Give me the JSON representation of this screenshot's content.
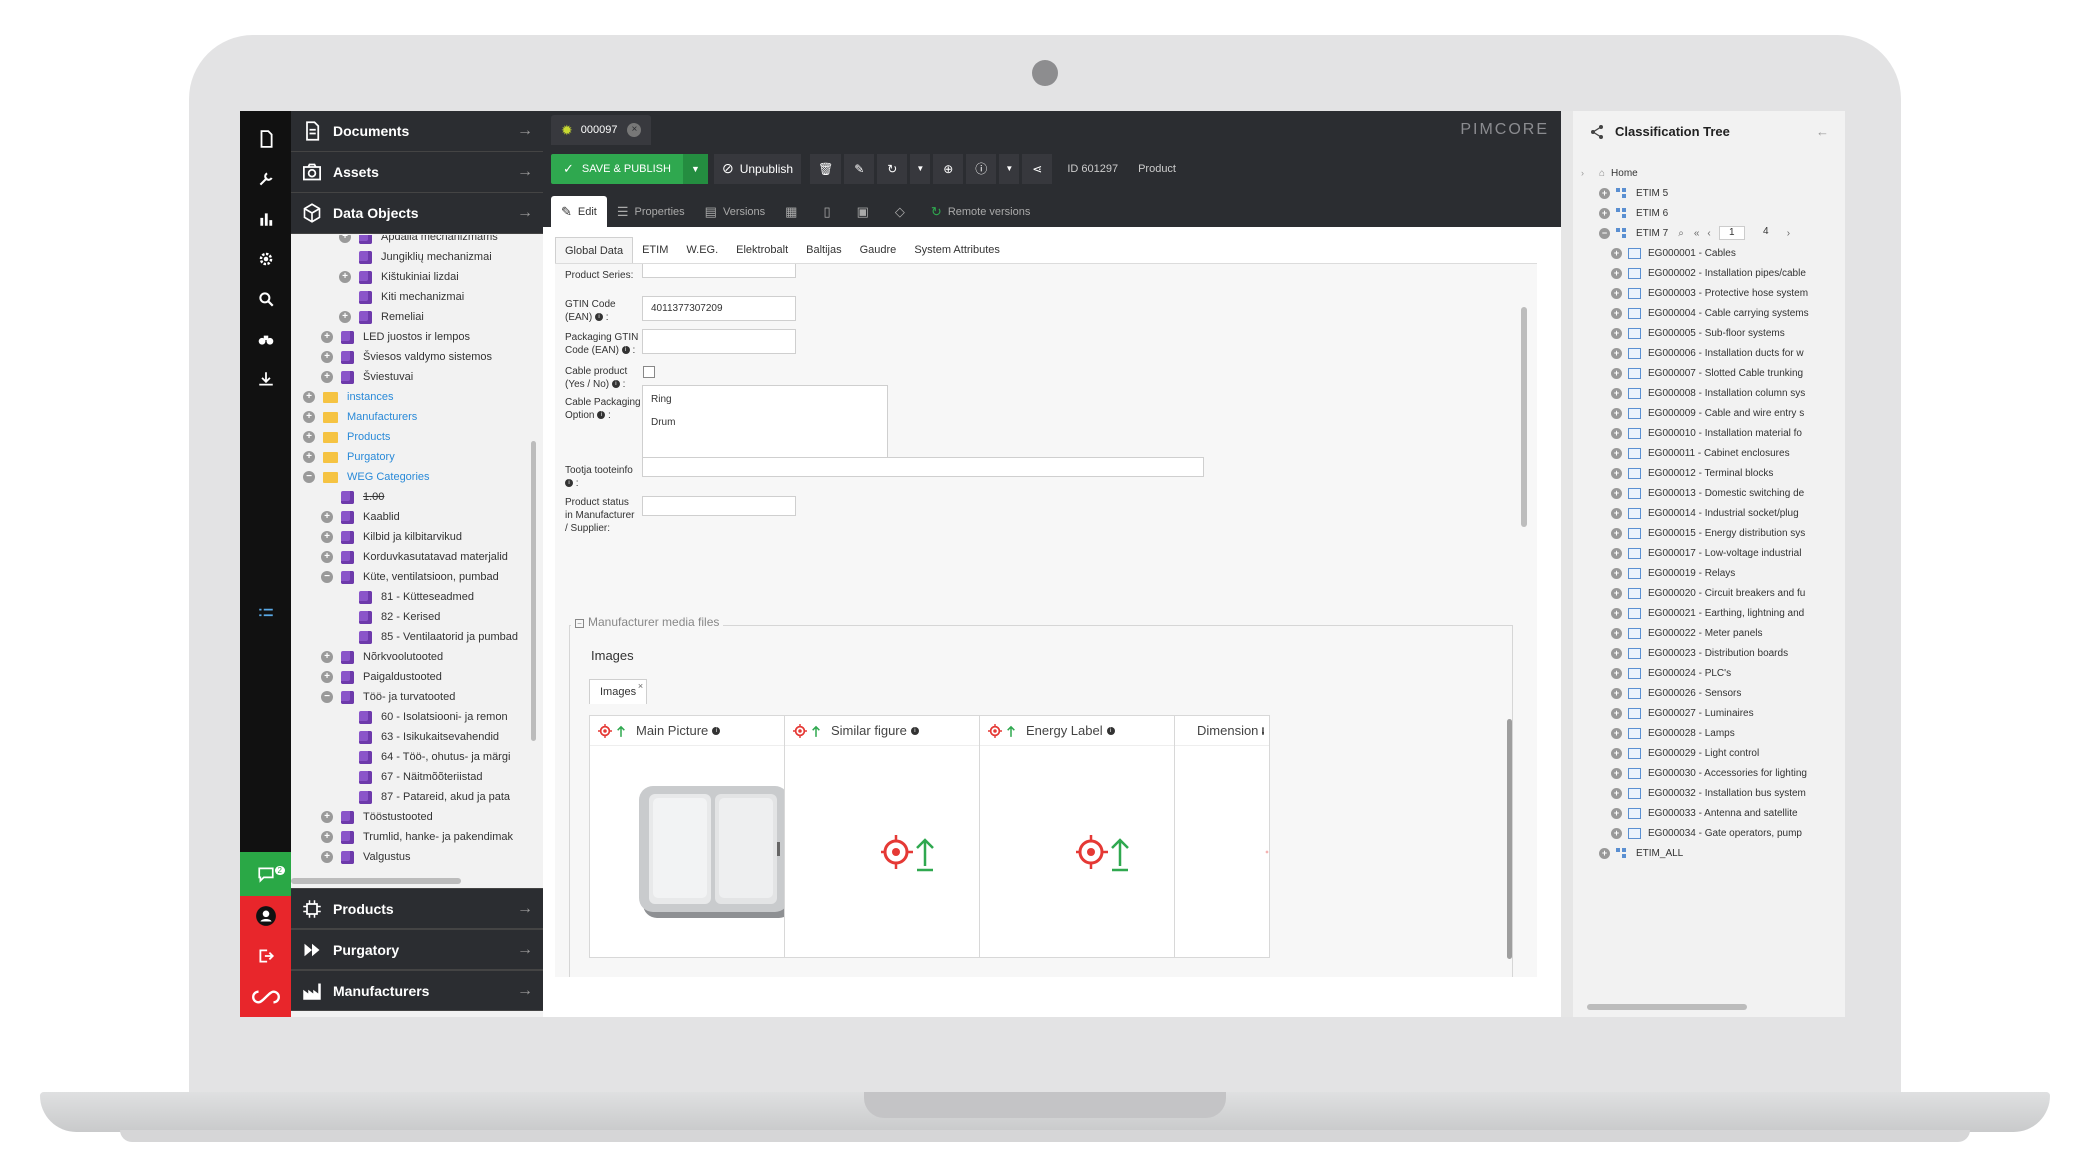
{
  "left_panels": {
    "documents": "Documents",
    "assets": "Assets",
    "data_objects": "Data Objects",
    "products": "Products",
    "purgatory": "Purgatory",
    "manufacturers": "Manufacturers"
  },
  "notifications_count": "2",
  "tree": [
    {
      "label": "Apdaila mechanizmams",
      "kind": "obj",
      "exp": "plus",
      "indent": 2
    },
    {
      "label": "Jungiklių mechanizmai",
      "kind": "obj",
      "exp": "none",
      "indent": 2
    },
    {
      "label": "Kištukiniai lizdai",
      "kind": "obj",
      "exp": "plus",
      "indent": 2
    },
    {
      "label": "Kiti mechanizmai",
      "kind": "obj",
      "exp": "none",
      "indent": 2
    },
    {
      "label": "Remeliai",
      "kind": "obj",
      "exp": "plus",
      "indent": 2
    },
    {
      "label": "LED juostos ir lempos",
      "kind": "obj",
      "exp": "plus",
      "indent": 1
    },
    {
      "label": "Šviesos valdymo sistemos",
      "kind": "obj",
      "exp": "plus",
      "indent": 1
    },
    {
      "label": "Šviestuvai",
      "kind": "obj",
      "exp": "plus",
      "indent": 1
    },
    {
      "label": "instances",
      "kind": "folder",
      "exp": "plus",
      "indent": 0,
      "blue": true
    },
    {
      "label": "Manufacturers",
      "kind": "folder",
      "exp": "plus",
      "indent": 0,
      "blue": true
    },
    {
      "label": "Products",
      "kind": "folder",
      "exp": "plus",
      "indent": 0,
      "blue": true
    },
    {
      "label": "Purgatory",
      "kind": "folder",
      "exp": "plus",
      "indent": 0,
      "blue": true
    },
    {
      "label": "WEG Categories",
      "kind": "folder",
      "exp": "minus",
      "indent": 0,
      "blue": true
    },
    {
      "label": "1.00",
      "kind": "obj",
      "exp": "none",
      "indent": 1,
      "strike": true
    },
    {
      "label": "Kaablid",
      "kind": "obj",
      "exp": "plus",
      "indent": 1
    },
    {
      "label": "Kilbid ja kilbitarvikud",
      "kind": "obj",
      "exp": "plus",
      "indent": 1
    },
    {
      "label": "Korduvkasutatavad materjalid",
      "kind": "obj",
      "exp": "plus",
      "indent": 1
    },
    {
      "label": "Küte, ventilatsioon, pumbad",
      "kind": "obj",
      "exp": "minus",
      "indent": 1
    },
    {
      "label": "81 - Kütteseadmed",
      "kind": "obj",
      "exp": "none",
      "indent": 2
    },
    {
      "label": "82 - Kerised",
      "kind": "obj",
      "exp": "none",
      "indent": 2
    },
    {
      "label": "85 - Ventilaatorid ja pumbad",
      "kind": "obj",
      "exp": "none",
      "indent": 2
    },
    {
      "label": "Nõrkvoolutooted",
      "kind": "obj",
      "exp": "plus",
      "indent": 1
    },
    {
      "label": "Paigaldustooted",
      "kind": "obj",
      "exp": "plus",
      "indent": 1
    },
    {
      "label": "Töö- ja turvatooted",
      "kind": "obj",
      "exp": "minus",
      "indent": 1
    },
    {
      "label": "60 - Isolatsiooni- ja remon",
      "kind": "obj",
      "exp": "none",
      "indent": 2
    },
    {
      "label": "63 - Isikukaitsevahendid",
      "kind": "obj",
      "exp": "none",
      "indent": 2
    },
    {
      "label": "64 - Töö-, ohutus- ja märgi",
      "kind": "obj",
      "exp": "none",
      "indent": 2
    },
    {
      "label": "67 - Näitmõõteriistad",
      "kind": "obj",
      "exp": "none",
      "indent": 2
    },
    {
      "label": "87 - Patareid, akud ja pata",
      "kind": "obj",
      "exp": "none",
      "indent": 2
    },
    {
      "label": "Tööstustooted",
      "kind": "obj",
      "exp": "plus",
      "indent": 1
    },
    {
      "label": "Trumlid, hanke- ja pakendimak",
      "kind": "obj",
      "exp": "plus",
      "indent": 1
    },
    {
      "label": "Valgustus",
      "kind": "obj",
      "exp": "plus",
      "indent": 1
    }
  ],
  "editor": {
    "tab_title": "000097",
    "logo": "PIMCORE",
    "save_publish": "SAVE & PUBLISH",
    "unpublish": "Unpublish",
    "object_id": "ID 601297",
    "class_name": "Product",
    "subtabs": {
      "edit": "Edit",
      "properties": "Properties",
      "versions": "Versions",
      "remote_versions": "Remote versions"
    },
    "inner_tabs": [
      "Global Data",
      "ETIM",
      "W.EG.",
      "Elektrobalt",
      "Baltijas",
      "Gaudre",
      "System Attributes"
    ]
  },
  "form": {
    "product_series_label": "Product Series:",
    "gtin_label_1": "GTIN Code",
    "gtin_label_2": "(EAN)",
    "gtin_value": "4011377307209",
    "pack_gtin_label_1": "Packaging GTIN",
    "pack_gtin_label_2": "Code (EAN)",
    "cable_product_label_1": "Cable product",
    "cable_product_label_2": "(Yes / No)",
    "cable_pack_label_1": "Cable Packaging",
    "cable_pack_label_2": "Option",
    "cable_pack_options": [
      "Ring",
      "Drum"
    ],
    "tootja_label_1": "Tootja tooteinfo",
    "status_label_1": "Product status",
    "status_label_2": "in Manufacturer",
    "status_label_3": "/ Supplier:",
    "media_legend": "Manufacturer media files",
    "images_heading": "Images",
    "images_tab": "Images",
    "cards": [
      "Main Picture",
      "Similar figure",
      "Energy Label",
      "Dimension"
    ]
  },
  "classification": {
    "title": "Classification Tree",
    "home": "Home",
    "etim5": "ETIM 5",
    "etim6": "ETIM 6",
    "etim7": "ETIM 7",
    "page_current": "1",
    "page_total": "4",
    "items": [
      "EG000001 - Cables",
      "EG000002 - Installation pipes/cable",
      "EG000003 - Protective hose system",
      "EG000004 - Cable carrying systems",
      "EG000005 - Sub-floor systems",
      "EG000006 - Installation ducts for w",
      "EG000007 - Slotted Cable trunking",
      "EG000008 - Installation column sys",
      "EG000009 - Cable and wire entry s",
      "EG000010 - Installation material fo",
      "EG000011 - Cabinet enclosures",
      "EG000012 - Terminal blocks",
      "EG000013 - Domestic switching de",
      "EG000014 - Industrial socket/plug",
      "EG000015 - Energy distribution sys",
      "EG000017 - Low-voltage industrial",
      "EG000019 - Relays",
      "EG000020 - Circuit breakers and fu",
      "EG000021 - Earthing, lightning and",
      "EG000022 - Meter panels",
      "EG000023 - Distribution boards",
      "EG000024 - PLC's",
      "EG000026 - Sensors",
      "EG000027 - Luminaires",
      "EG000028 - Lamps",
      "EG000029 - Light control",
      "EG000030 - Accessories for lighting",
      "EG000032 - Installation bus system",
      "EG000033 - Antenna and satellite",
      "EG000034 - Gate operators, pump"
    ],
    "etim_all": "ETIM_ALL"
  }
}
